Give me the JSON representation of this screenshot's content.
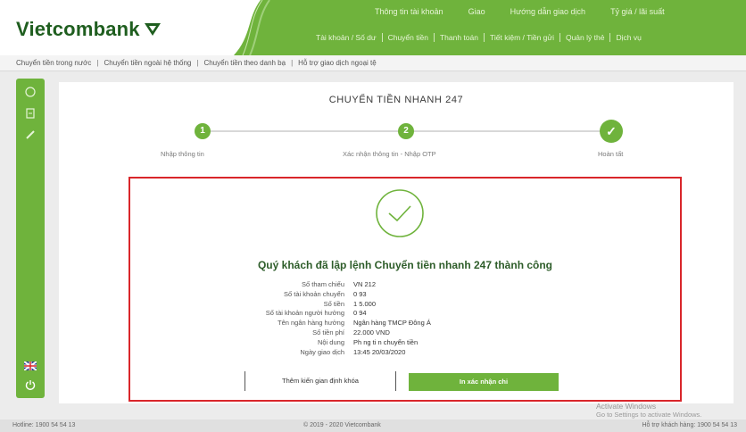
{
  "brand": {
    "name": "Vietcombank",
    "primary_color": "#6fb33c",
    "dark_green": "#1f5e1f",
    "alert_color": "#d9262b"
  },
  "header": {
    "top_links": [
      "Thông tin tài khoản",
      "Giao",
      "Hướng dẫn giao dịch",
      "Tỷ giá / lãi suất"
    ],
    "main_menu": [
      "Tài khoản / Số dư",
      "Chuyển tiền",
      "Thanh toán",
      "Tiết kiệm / Tiền gửi",
      "Quản lý thẻ",
      "Dịch vụ"
    ]
  },
  "subnav": [
    "Chuyển tiền trong nước",
    "Chuyển tiền ngoài hệ thống",
    "Chuyển tiền theo danh bạ",
    "Hỗ trợ giao dịch ngoại tệ"
  ],
  "rail_icons": [
    "home-icon",
    "list-icon",
    "edit-icon",
    "flag-uk-icon",
    "power-icon"
  ],
  "page": {
    "title": "CHUYỂN TIỀN NHANH 247"
  },
  "steps": [
    {
      "number": "1",
      "label": "Nhập thông tin"
    },
    {
      "number": "2",
      "label": "Xác nhận thông tin - Nhập OTP"
    },
    {
      "number": "✓",
      "label": "Hoàn tất"
    }
  ],
  "result": {
    "message": "Quý khách đã lập lệnh Chuyển tiền nhanh 247 thành công",
    "details": [
      {
        "label": "Số tham chiếu",
        "value": "VN 212"
      },
      {
        "label": "Số tài khoản chuyển",
        "value": "0 93"
      },
      {
        "label": "Số tiền",
        "value": "1 5.000"
      },
      {
        "label": "Số tài khoản người hưởng",
        "value": "0 94"
      },
      {
        "label": "Tên ngân hàng hưởng",
        "value": "Ngân hàng TMCP Đông Á"
      },
      {
        "label": "Số tiền phí",
        "value": "22.000 VND"
      },
      {
        "label": "Nội dung",
        "value": "Ph ng ti n chuyển tiền"
      },
      {
        "label": "Ngày giao dịch",
        "value": "13:45 20/03/2020"
      }
    ],
    "buttons": {
      "secondary": "Thêm kiến gian định khóa",
      "primary": "In xác nhận chi"
    }
  },
  "footer": {
    "left": "Hotline: 1900 54 54 13",
    "center": "© 2019 - 2020 Vietcombank",
    "right": "Hỗ trợ khách hàng: 1900 54 54 13"
  },
  "watermark": {
    "line1": "Activate Windows",
    "line2": "Go to Settings to activate Windows."
  }
}
